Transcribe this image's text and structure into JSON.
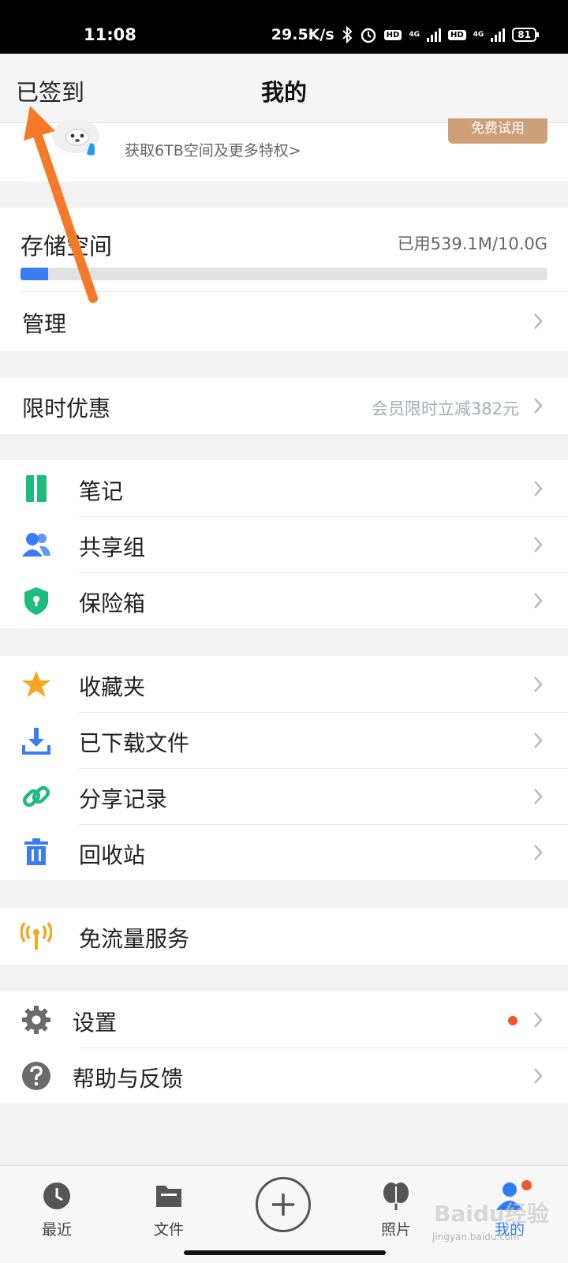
{
  "status": {
    "time": "11:08",
    "speed": "29.5K/s",
    "hd": "HD",
    "net": "4G",
    "battery": "81"
  },
  "header": {
    "left": "已签到",
    "title": "我的"
  },
  "profile": {
    "promo": "获取6TB空间及更多特权>",
    "trial_button": "免费试用"
  },
  "storage": {
    "title": "存储空间",
    "used": "已用539.1M/10.0G",
    "used_fraction": 0.053
  },
  "manage": {
    "label": "管理"
  },
  "offer": {
    "label": "限时优惠",
    "detail": "会员限时立减382元"
  },
  "tools": [
    {
      "label": "笔记",
      "icon": "note-icon",
      "color": "#1dbb7e"
    },
    {
      "label": "共享组",
      "icon": "group-icon",
      "color": "#3a7cf3"
    },
    {
      "label": "保险箱",
      "icon": "safe-shield-icon",
      "color": "#1dbb7e"
    }
  ],
  "files": [
    {
      "label": "收藏夹",
      "icon": "star-icon",
      "color": "#f6a623"
    },
    {
      "label": "已下载文件",
      "icon": "download-icon",
      "color": "#3a7cf3"
    },
    {
      "label": "分享记录",
      "icon": "link-icon",
      "color": "#1dbb7e"
    },
    {
      "label": "回收站",
      "icon": "trash-icon",
      "color": "#3a7cf3"
    }
  ],
  "free_traffic": {
    "label": "免流量服务",
    "icon": "antenna-icon",
    "color": "#f6a623"
  },
  "settings": {
    "label": "设置",
    "icon": "gear-icon"
  },
  "help": {
    "label": "帮助与反馈",
    "icon": "help-icon"
  },
  "tabs": [
    {
      "label": "最近",
      "icon": "clock-icon"
    },
    {
      "label": "文件",
      "icon": "folder-icon"
    },
    {
      "label": "",
      "icon": "plus-icon"
    },
    {
      "label": "照片",
      "icon": "photo-icon"
    },
    {
      "label": "我的",
      "icon": "user-icon"
    }
  ],
  "watermark": {
    "brand": "Baidu经验",
    "url": "jingyan.baidu.com"
  },
  "colors": {
    "accent": "#3a7cf3",
    "annotation": "#f47a2a",
    "badge": "#f2552c"
  }
}
